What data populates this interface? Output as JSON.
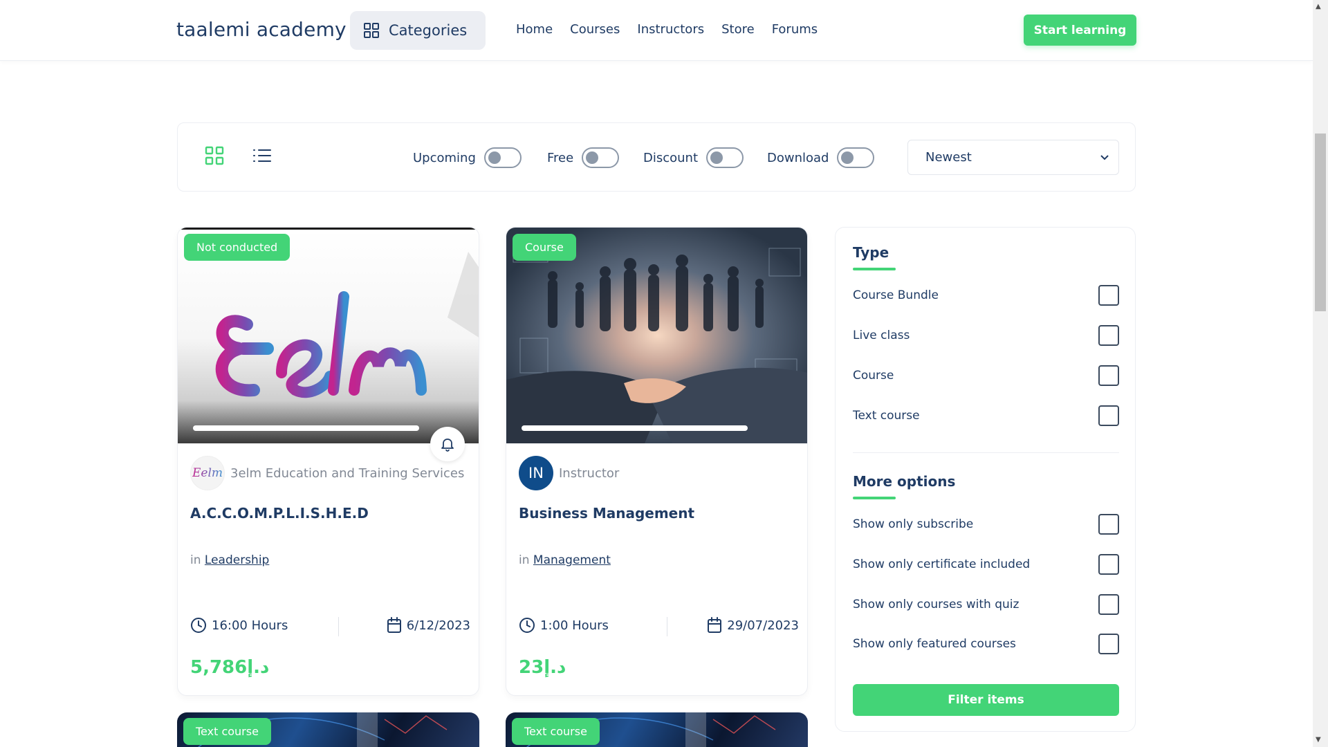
{
  "header": {
    "logo": "taalemi academy",
    "categories_label": "Categories",
    "nav": [
      "Home",
      "Courses",
      "Instructors",
      "Store",
      "Forums"
    ],
    "cta_label": "Start learning"
  },
  "filters": {
    "toggles": [
      {
        "label": "Upcoming",
        "on": false
      },
      {
        "label": "Free",
        "on": false
      },
      {
        "label": "Discount",
        "on": false
      },
      {
        "label": "Download",
        "on": false
      }
    ],
    "sort_selected": "Newest",
    "view_mode": "grid"
  },
  "courses": [
    {
      "badge": "Not conducted",
      "author": "3elm Education and Training Services",
      "title": "A.C.C.O.M.P.L.I.S.H.E.D",
      "category_prefix": "in",
      "category": "Leadership",
      "duration": "16:00 Hours",
      "date": "6/12/2023",
      "price": "5,786د.إ"
    },
    {
      "badge": "Course",
      "author": "Instructor",
      "avatar_initials": "IN",
      "title": "Business Management",
      "category_prefix": "in",
      "category": "Management",
      "duration": "1:00 Hours",
      "date": "29/07/2023",
      "price": "23د.إ"
    },
    {
      "badge": "Text course"
    },
    {
      "badge": "Text course"
    }
  ],
  "sidebar": {
    "type_heading": "Type",
    "type_options": [
      "Course Bundle",
      "Live class",
      "Course",
      "Text course"
    ],
    "more_heading": "More options",
    "more_options": [
      "Show only subscribe",
      "Show only certificate included",
      "Show only courses with quiz",
      "Show only featured courses"
    ],
    "filter_button": "Filter items"
  },
  "colors": {
    "accent": "#43d477",
    "primary_text": "#1f3b64",
    "muted_text": "#818894"
  }
}
